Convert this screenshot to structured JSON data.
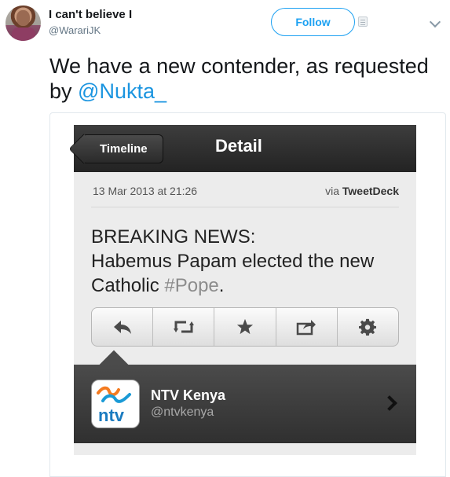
{
  "tweet": {
    "display_name": "I can't believe I",
    "handle": "@WarariJK",
    "follow_label": "Follow",
    "text_prefix": "We have a new contender, as requested by ",
    "mention": "@Nukta_"
  },
  "embedded_screenshot": {
    "nav": {
      "back_label": "Timeline",
      "title": "Detail"
    },
    "meta": {
      "date": "13 Mar 2013 at 21:26",
      "via_prefix": "via ",
      "via_app": "TweetDeck"
    },
    "body": {
      "line1": "BREAKING NEWS:",
      "line2": "Habemus Papam elected the new",
      "line3_prefix": "Catholic ",
      "hashtag": "#Pope",
      "line3_suffix": "."
    },
    "actions": [
      "reply-icon",
      "retweet-icon",
      "favorite-icon",
      "share-icon",
      "settings-icon"
    ],
    "user": {
      "name": "NTV Kenya",
      "handle": "@ntvkenya"
    }
  },
  "colors": {
    "accent": "#1da1f2",
    "mention": "#1b95e0"
  }
}
